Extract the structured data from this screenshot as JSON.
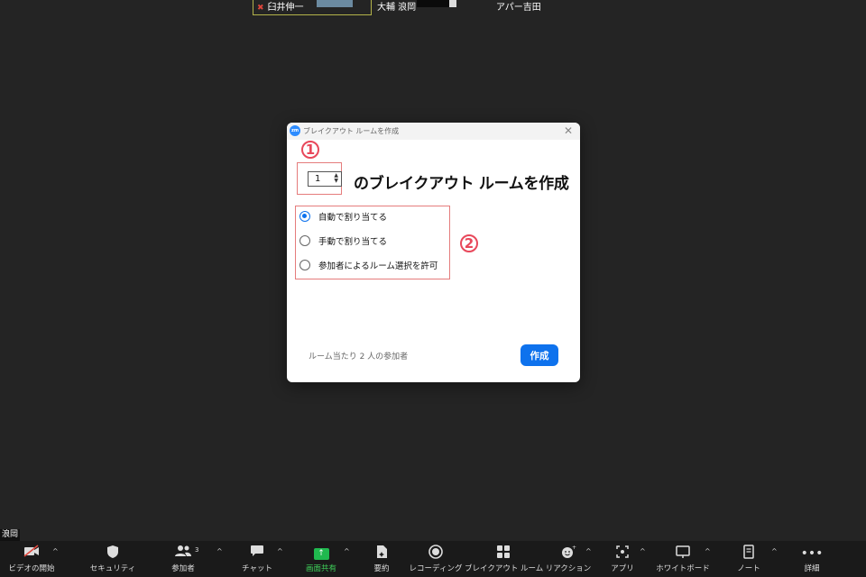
{
  "gallery": {
    "tiles": [
      {
        "name": "臼井伸一",
        "muted": true
      },
      {
        "name": "大輔 浪岡"
      },
      {
        "name": "アパー吉田"
      }
    ]
  },
  "dialog": {
    "window_title": "ブレイクアウト ルームを作成",
    "logo": "zm",
    "callout_1": "1",
    "callout_2": "2",
    "room_count_value": "1",
    "heading": "のブレイクアウト ルームを作成",
    "options": [
      {
        "label": "自動で割り当てる",
        "selected": true
      },
      {
        "label": "手動で割り当てる",
        "selected": false
      },
      {
        "label": "参加者によるルーム選択を許可",
        "selected": false
      }
    ],
    "participants_per_room": "ルーム当たり 2 人の参加者",
    "create_button": "作成"
  },
  "self_name": "浪岡",
  "toolbar": {
    "items": [
      {
        "label": "ビデオの開始",
        "icon": "video-off-icon"
      },
      {
        "label": "セキュリティ",
        "icon": "shield-icon"
      },
      {
        "label": "参加者",
        "icon": "participants-icon",
        "count": "3"
      },
      {
        "label": "チャット",
        "icon": "chat-icon"
      },
      {
        "label": "画面共有",
        "icon": "share-screen-icon"
      },
      {
        "label": "要約",
        "icon": "summary-icon"
      },
      {
        "label": "レコーディング",
        "icon": "record-icon"
      },
      {
        "label": "ブレイクアウト ルーム",
        "icon": "breakout-rooms-icon"
      },
      {
        "label": "リアクション",
        "icon": "reaction-icon"
      },
      {
        "label": "アプリ",
        "icon": "apps-icon"
      },
      {
        "label": "ホワイトボード",
        "icon": "whiteboard-icon"
      },
      {
        "label": "ノート",
        "icon": "notes-icon"
      },
      {
        "label": "詳細",
        "icon": "more-icon"
      }
    ]
  },
  "colors": {
    "accent": "#0e72ed",
    "callout": "#e8485b",
    "share_green": "#20b94f",
    "background": "#242424"
  }
}
